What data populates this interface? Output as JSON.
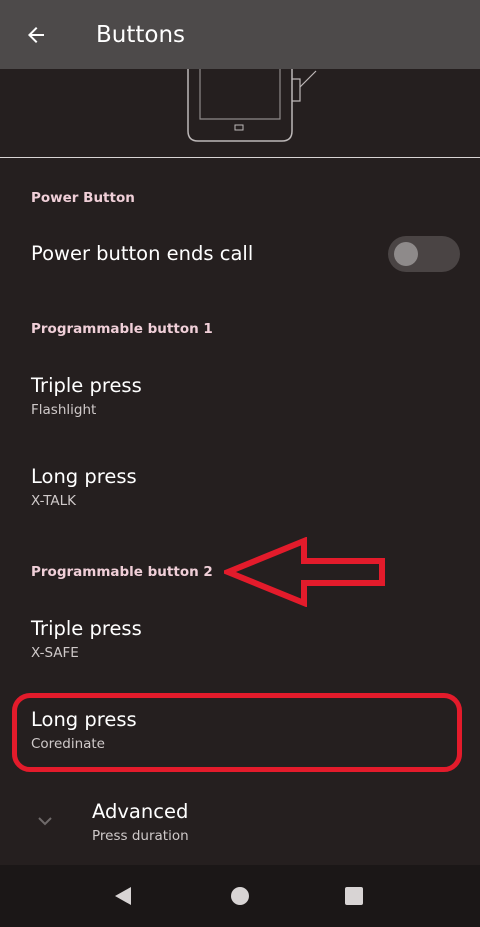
{
  "appbar": {
    "title": "Buttons",
    "back_icon": "arrow-back-icon"
  },
  "sections": {
    "power": {
      "header": "Power Button",
      "ends_call": {
        "title": "Power button ends call",
        "switch_on": false
      }
    },
    "prog1": {
      "header": "Programmable button 1",
      "triple": {
        "title": "Triple press",
        "summary": "Flashlight"
      },
      "long": {
        "title": "Long press",
        "summary": "X-TALK"
      }
    },
    "prog2": {
      "header": "Programmable button 2",
      "triple": {
        "title": "Triple press",
        "summary": "X-SAFE"
      },
      "long": {
        "title": "Long press",
        "summary": "Coredinate"
      }
    }
  },
  "advanced": {
    "title": "Advanced",
    "summary": "Press duration",
    "icon": "chevron-down-icon"
  },
  "navbar": {
    "back_icon": "nav-back-icon",
    "home_icon": "nav-home-icon",
    "recents_icon": "nav-recents-icon"
  },
  "colors": {
    "appbar": "#4d4a4a",
    "background": "#251f1f",
    "section_header": "#f0cfd8",
    "annotation_red": "#e31b2b",
    "navbar": "#1b1717"
  }
}
